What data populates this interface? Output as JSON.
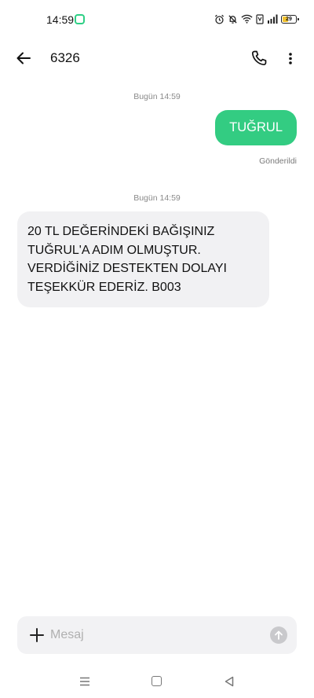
{
  "status_bar": {
    "time": "14:59",
    "battery": "29",
    "icons": [
      "alarm-icon",
      "silent-bell-icon",
      "wifi-icon",
      "volte-icon",
      "signal-icon",
      "battery-icon"
    ]
  },
  "header": {
    "contact": "6326",
    "icons": [
      "back-arrow-icon",
      "phone-icon",
      "more-vertical-icon"
    ]
  },
  "conversation": {
    "groups": [
      {
        "date": "Bugün 14:59"
      },
      {
        "date": "Bugün 14:59"
      }
    ],
    "outgoing_message": "TUĞRUL",
    "sent_status": "Gönderildi",
    "incoming_message": "20 TL DEĞERİNDEKİ BAĞIŞINIZ TUĞRUL'A ADIM OLMUŞTUR. VERDİĞİNİZ DESTEKTEN DOLAYI TEŞEKKÜR EDERİZ. B003"
  },
  "composer": {
    "placeholder": "Mesaj",
    "value": ""
  },
  "colors": {
    "accent": "#33cc82",
    "incoming_bubble": "#f1f1f3",
    "composer_bg": "#f2f2f4"
  }
}
